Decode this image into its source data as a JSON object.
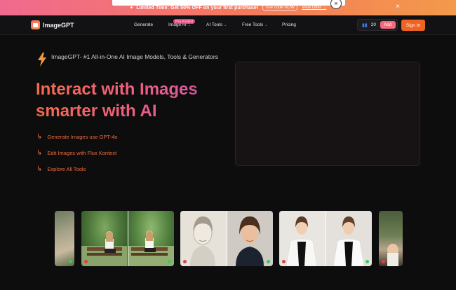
{
  "promo": {
    "icon": "sparkle-icon",
    "text": "Limited Time: Get 50% OFF on your first purchase!",
    "code_label": "Use code NOW",
    "view_label": "View Offer →",
    "close_glyph": "×"
  },
  "popup": {
    "close_glyph": "×"
  },
  "header": {
    "logo_text": "ImageGPT",
    "nav": [
      {
        "label": "Generate"
      },
      {
        "label": "Image AI",
        "badge": "Flux Kontext"
      },
      {
        "label": "AI Tools"
      },
      {
        "label": "Free Tools"
      },
      {
        "label": "Pricing"
      }
    ],
    "credits": "20",
    "add_label": "Add",
    "signin_label": "Sign In"
  },
  "hero": {
    "tagline": "ImageGPT- #1 All-in-One AI Image Models, Tools & Generators",
    "headline": "Interact with Images smarter with AI",
    "links": [
      "Generate Images use GPT-4o",
      "Edit Images with Flux Kontext",
      "Explore All Tools"
    ]
  },
  "colors": {
    "accent": "#f06423",
    "brand_gradient_start": "#f46b4a",
    "brand_gradient_end": "#dd5a9a",
    "background": "#0d0d0e"
  }
}
